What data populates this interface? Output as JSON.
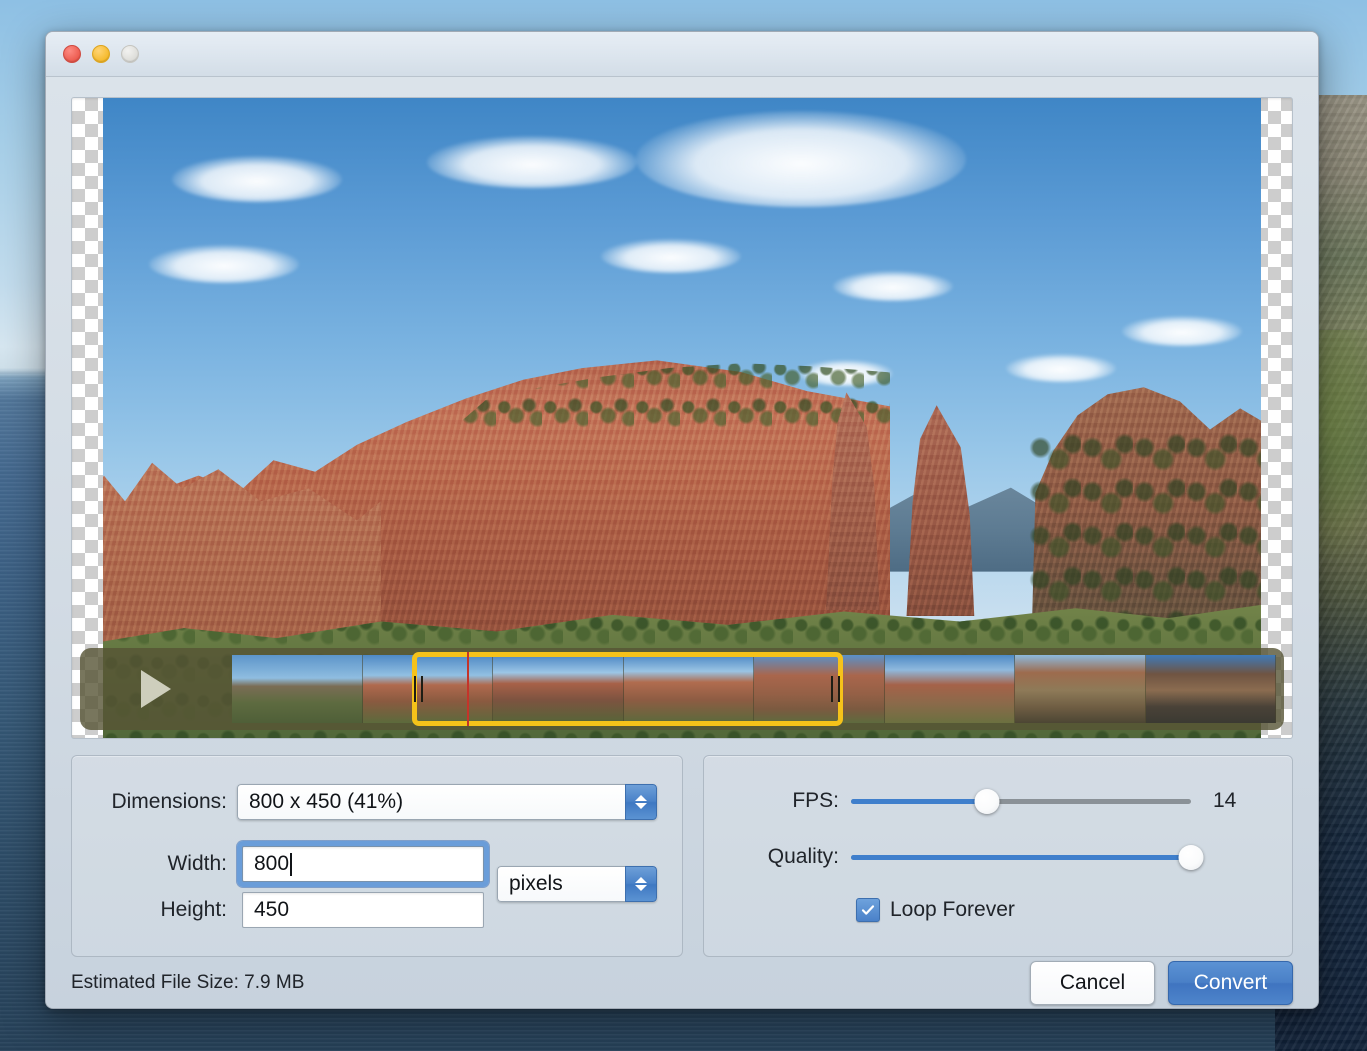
{
  "window": {
    "title": "",
    "traffic_lights": [
      {
        "name": "close",
        "color": "#ec5b4f",
        "label": "Close"
      },
      {
        "name": "minimize",
        "color": "#f5ba2c",
        "label": "Minimize"
      },
      {
        "name": "zoom",
        "color": "#dcdcd8",
        "label": "Zoom"
      }
    ]
  },
  "preview": {
    "scrubber": {
      "play_icon": "play-triangle-icon",
      "frame_count": 8,
      "trim": {
        "start_pct": 17.2,
        "width_pct": 41.3
      },
      "playhead_pct": 22.5,
      "left_handle_icon": "trim-handle-left-icon",
      "right_handle_icon": "trim-handle-right-icon"
    }
  },
  "settings": {
    "dimensions": {
      "label": "Dimensions:",
      "value": "800 x 450 (41%)",
      "stepper_icon": "stepper-updown-icon"
    },
    "width": {
      "label": "Width:",
      "value": "800",
      "focused": true
    },
    "height": {
      "label": "Height:",
      "value": "450"
    },
    "units": {
      "value": "pixels",
      "stepper_icon": "stepper-updown-icon"
    }
  },
  "output": {
    "fps": {
      "label": "FPS:",
      "value": "14",
      "fill_pct": 40
    },
    "quality": {
      "label": "Quality:",
      "fill_pct": 100
    },
    "loop": {
      "label": "Loop Forever",
      "checked": true,
      "check_icon": "checkmark-icon"
    }
  },
  "footer": {
    "file_size": "Estimated File Size: 7.9 MB",
    "cancel_label": "Cancel",
    "convert_label": "Convert"
  },
  "colors": {
    "accent_blue": "#4a80c7",
    "trim_yellow": "#f5c21a",
    "playhead_red": "#c4342a",
    "window_bg": "#d5dde6"
  }
}
